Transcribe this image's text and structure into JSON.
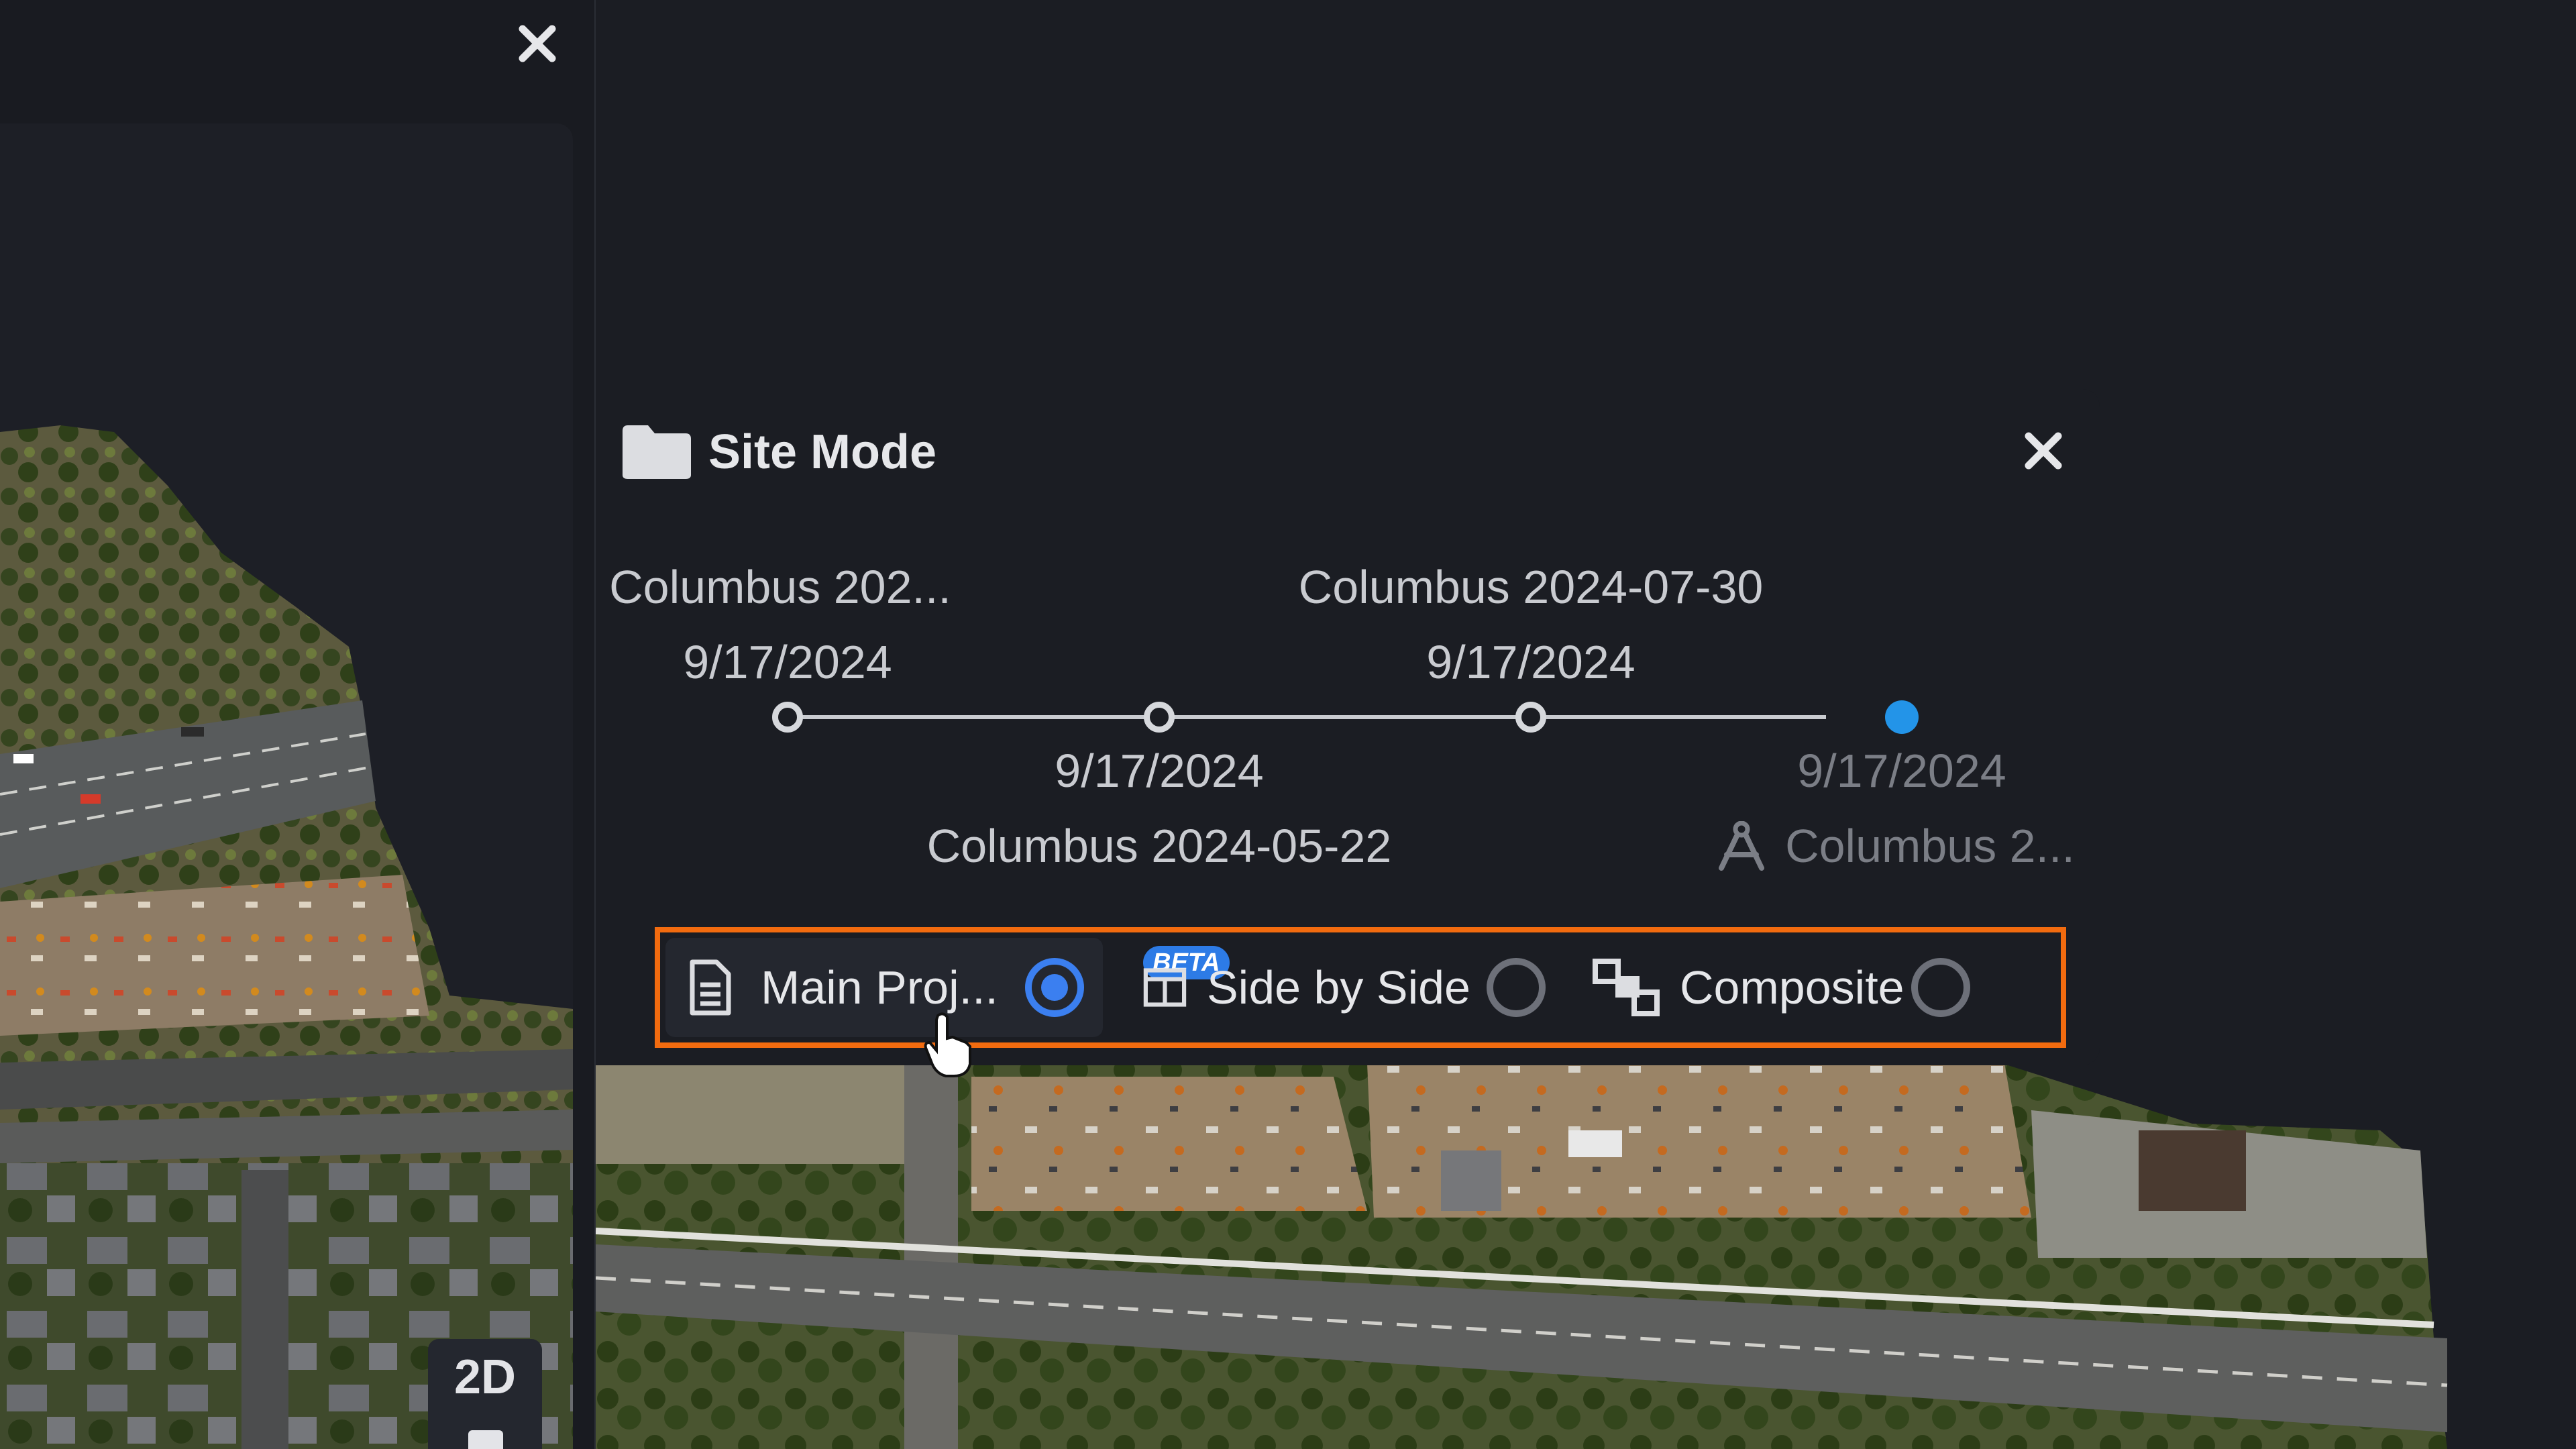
{
  "site_panel": {
    "title": "Site Mode",
    "timeline": {
      "top_items": [
        {
          "name": "Columbus 202...",
          "date": "9/17/2024"
        },
        {
          "name": "Columbus 2024-07-30",
          "date": "9/17/2024"
        }
      ],
      "bottom_items": [
        {
          "name": "Columbus 2024-05-22",
          "date": "9/17/2024"
        },
        {
          "name": "Columbus 2...",
          "date": "9/17/2024"
        }
      ],
      "active_node_color": "#2394e8"
    },
    "modes": [
      {
        "label": "Main Proj...",
        "icon": "document-icon",
        "selected": true
      },
      {
        "label": "Side by Side",
        "icon": "columns-icon",
        "badge": "BETA",
        "selected": false
      },
      {
        "label": "Composite",
        "icon": "composite-icon",
        "selected": false
      }
    ],
    "highlight_color": "#f26b0f"
  },
  "left_panel": {
    "view_toggle": "2D"
  }
}
